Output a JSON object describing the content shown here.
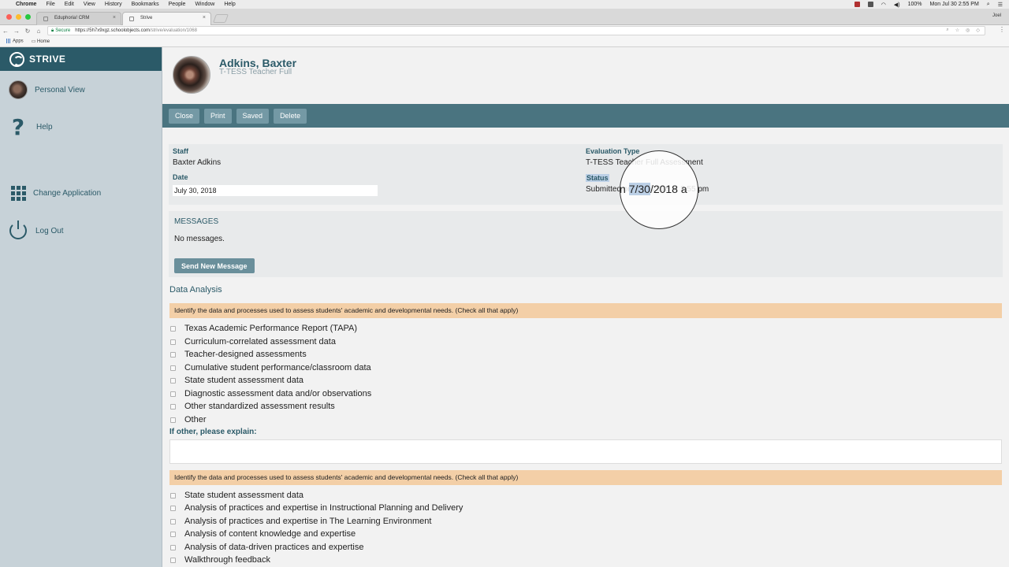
{
  "menubar": {
    "items": [
      "Chrome",
      "File",
      "Edit",
      "View",
      "History",
      "Bookmarks",
      "People",
      "Window",
      "Help"
    ],
    "battery": "100%",
    "clock": "Mon Jul 30  2:55 PM"
  },
  "browser": {
    "tabs": [
      {
        "title": "Eduphoria! CRM",
        "close": "×"
      },
      {
        "title": "Strive",
        "close": "×"
      }
    ],
    "profile": "Joel",
    "secure_label": "Secure",
    "url_host": "https://5h7x9xgz.schoolobjects.com",
    "url_path": "/strive/evaluation/1068",
    "bookmarks": [
      "Apps",
      "Home"
    ]
  },
  "sidebar": {
    "brand": "STRIVE",
    "items": [
      {
        "label": "Personal View",
        "icon": "avatar"
      },
      {
        "label": "Help",
        "icon": "question-icon"
      },
      {
        "label": "Change Application",
        "icon": "grid-icon"
      },
      {
        "label": "Log Out",
        "icon": "power-icon"
      }
    ]
  },
  "profile": {
    "name": "Adkins, Baxter",
    "subtitle": "T-TESS Teacher Full"
  },
  "actions": [
    "Close",
    "Print",
    "Saved",
    "Delete"
  ],
  "info": {
    "staff_label": "Staff",
    "staff_value": "Baxter Adkins",
    "date_label": "Date",
    "date_value": "July 30, 2018",
    "eval_type_label": "Evaluation Type",
    "eval_type_value": "T-TESS Teacher Full Assessment",
    "status_label": "Status",
    "status_value": "Submitted on 7/30/2018 at 2:55 pm"
  },
  "magnifier": {
    "pre": "n ",
    "highlight": "7/30",
    "post": "/2018 a"
  },
  "messages": {
    "title": "MESSAGES",
    "empty": "No messages.",
    "send_button": "Send New Message"
  },
  "data_analysis": {
    "title": "Data Analysis",
    "q1": {
      "prompt": "Identify the data and processes used to assess students' academic and developmental needs. (Check all that apply)",
      "options": [
        "Texas Academic Performance Report (TAPA)",
        "Curriculum-correlated assessment data",
        "Teacher-designed assessments",
        "Cumulative student performance/classroom data",
        "State student assessment data",
        "Diagnostic assessment data and/or observations",
        "Other standardized assessment results",
        "Other"
      ]
    },
    "other_label": "If other, please explain:",
    "q2": {
      "prompt": "Identify the data and processes used to assess students' academic and developmental needs. (Check all that apply)",
      "options": [
        "State student assessment data",
        "Analysis of practices and expertise in Instructional Planning and Delivery",
        "Analysis of practices and expertise in The Learning Environment",
        "Analysis of content knowledge and expertise",
        "Analysis of data-driven practices and expertise",
        "Walkthrough feedback"
      ]
    }
  }
}
